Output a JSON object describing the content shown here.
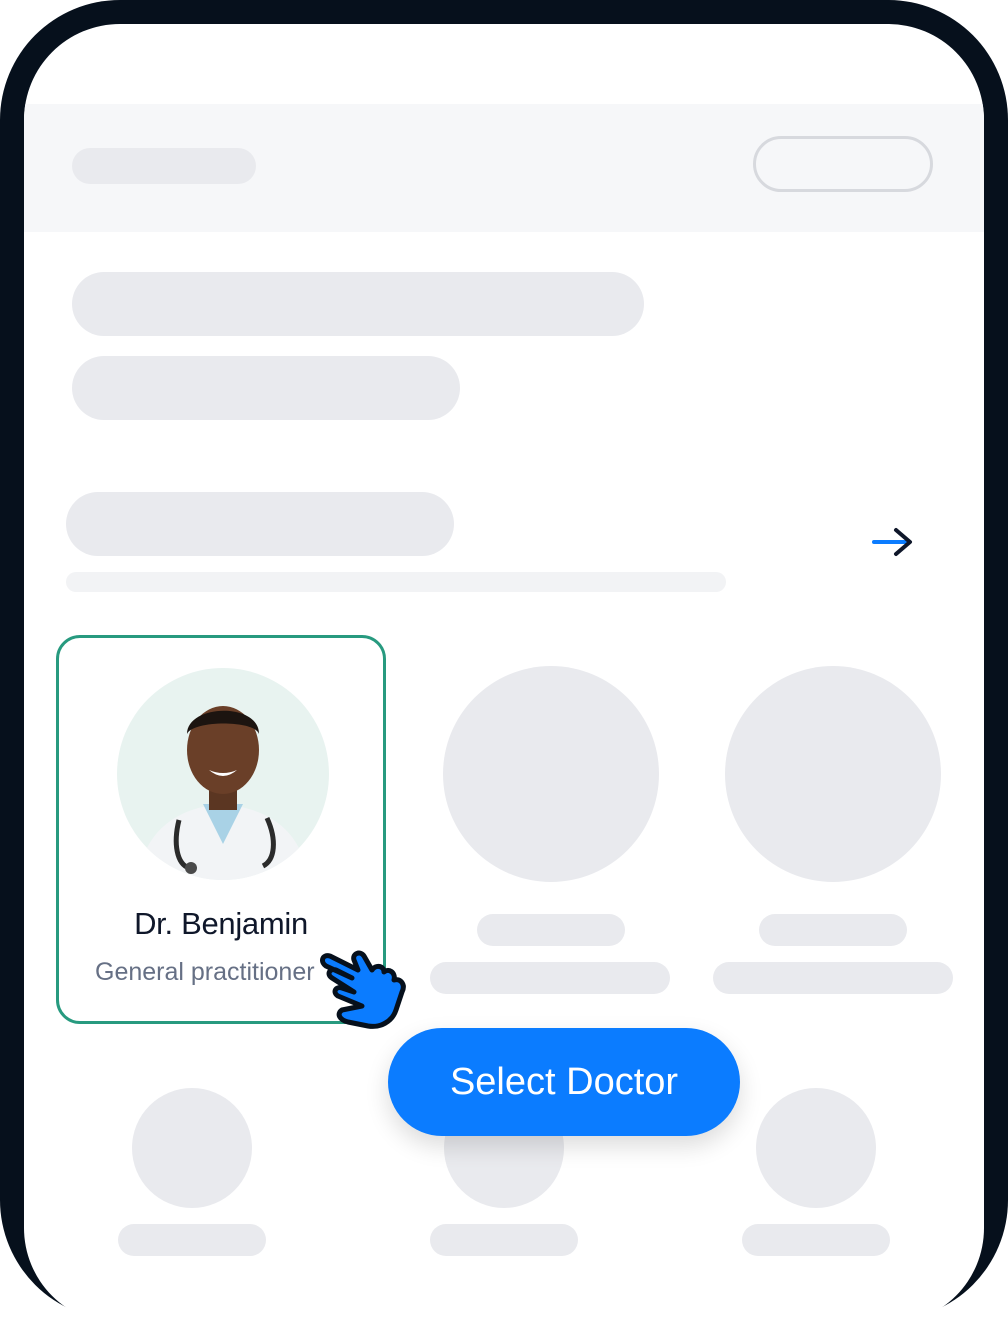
{
  "doctor_card": {
    "name": "Dr. Benjamin",
    "specialty": "General practitioner"
  },
  "primary_action": {
    "label": "Select Doctor"
  },
  "colors": {
    "accent": "#0b7cff",
    "selected_border": "#279a7f",
    "skeleton": "#e9eaee",
    "frame": "#06101c"
  },
  "icons": [
    "arrow-right-icon",
    "pointing-hand-icon"
  ]
}
